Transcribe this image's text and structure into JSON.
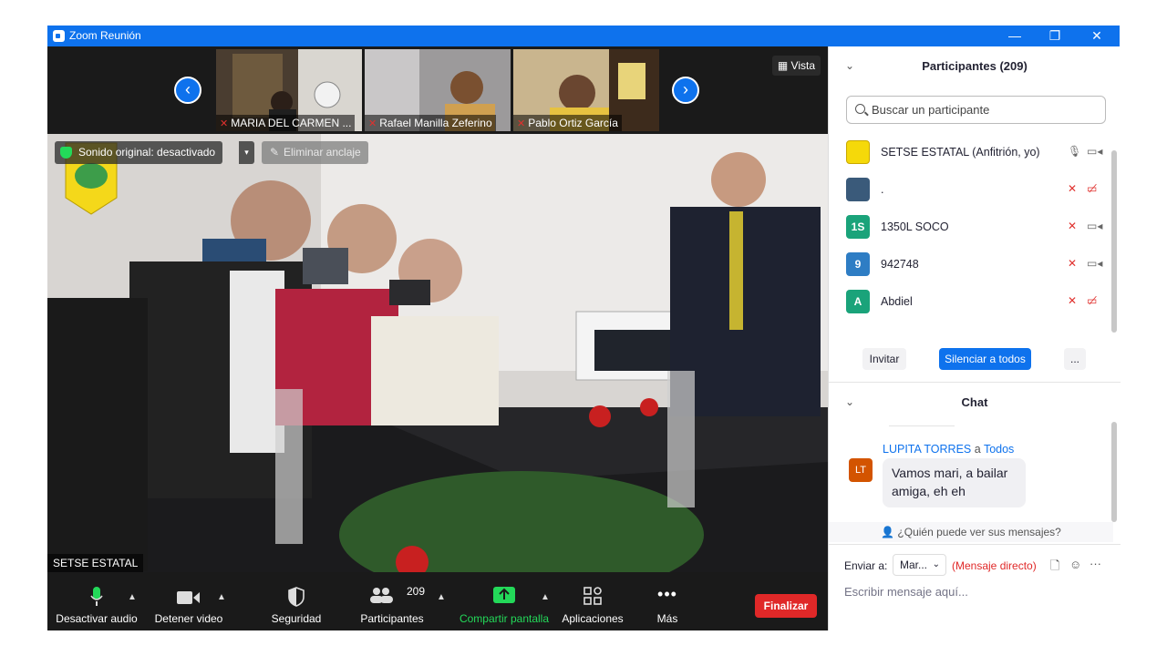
{
  "window": {
    "title": "Zoom Reunión",
    "minimize": "—",
    "restore": "❐",
    "close": "✕"
  },
  "strip": {
    "thumbs": [
      {
        "name": "MARIA DEL CARMEN ..."
      },
      {
        "name": "Rafael Manilla Zeferino"
      },
      {
        "name": "Pablo Ortiz García"
      }
    ],
    "view_label": "Vista"
  },
  "main_video": {
    "original_sound": "Sonido original: desactivado",
    "unpin": "Eliminar anclaje",
    "speaker": "SETSE ESTATAL"
  },
  "toolbar": {
    "mute": "Desactivar audio",
    "video": "Detener video",
    "security": "Seguridad",
    "participants": "Participantes",
    "participants_count": "209",
    "share": "Compartir pantalla",
    "apps": "Aplicaciones",
    "more": "Más",
    "end": "Finalizar"
  },
  "participants_panel": {
    "title": "Participantes (209)",
    "search_placeholder": "Buscar un participante",
    "list": [
      {
        "name": "SETSE ESTATAL (Anfitrión, yo)",
        "avatar": "",
        "color": "#f5d90a"
      },
      {
        "name": ".",
        "avatar": "",
        "color": "#3a5a7a"
      },
      {
        "name": "1350L SOCO",
        "avatar": "1S",
        "color": "#1aa37a"
      },
      {
        "name": "942748",
        "avatar": "9",
        "color": "#2e7dc4"
      },
      {
        "name": "Abdiel",
        "avatar": "A",
        "color": "#1aa37a"
      }
    ],
    "invite": "Invitar",
    "mute_all": "Silenciar a todos",
    "more": "..."
  },
  "chat": {
    "title": "Chat",
    "sender": "LUPITA TORRES",
    "to_word": "a",
    "recipient": "Todos",
    "avatar": "LT",
    "message": "Vamos mari, a bailar amiga, eh eh",
    "who_sees": "¿Quién puede ver sus mensajes?",
    "send_to_label": "Enviar a:",
    "send_to_value": "Mar...",
    "direct": "(Mensaje directo)",
    "input_placeholder": "Escribir mensaje aquí..."
  }
}
